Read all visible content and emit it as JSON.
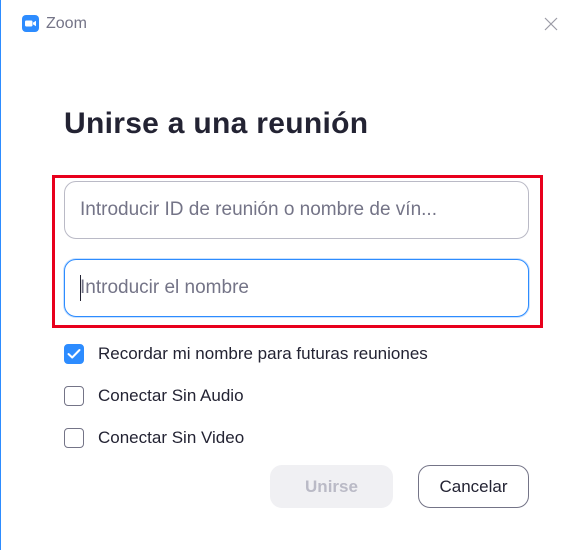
{
  "window": {
    "app_name": "Zoom",
    "icon": "zoom-camera-icon",
    "close_icon": "close-icon"
  },
  "dialog": {
    "heading": "Unirse a una reunión",
    "meeting_id_input": {
      "placeholder": "Introducir ID de reunión o nombre de vín...",
      "value": ""
    },
    "name_input": {
      "placeholder": "Introducir el nombre",
      "value": "",
      "focused": true
    },
    "options": [
      {
        "label": "Recordar mi nombre para futuras reuniones",
        "checked": true
      },
      {
        "label": "Conectar Sin Audio",
        "checked": false
      },
      {
        "label": "Conectar Sin Video",
        "checked": false
      }
    ],
    "join_button": {
      "label": "Unirse",
      "enabled": false
    },
    "cancel_button": {
      "label": "Cancelar"
    }
  },
  "colors": {
    "accent": "#2d8cff",
    "highlight": "#e8001c",
    "text": "#232333",
    "muted": "#747487",
    "disabled_bg": "#f0f0f3"
  }
}
